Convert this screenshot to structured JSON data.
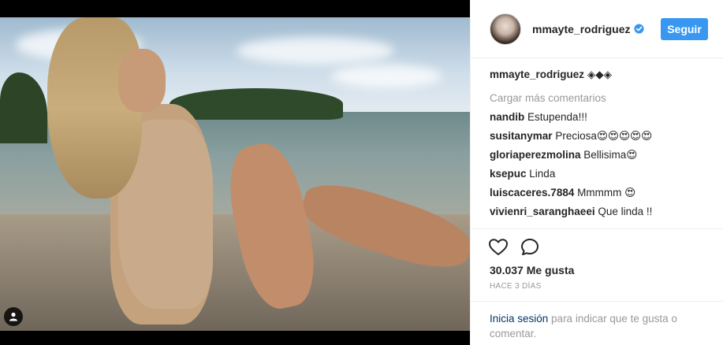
{
  "post": {
    "photo_alt": "",
    "author": {
      "username": "mmayte_rodriguez",
      "verified": true
    },
    "follow_label": "Seguir",
    "caption": {
      "username": "mmayte_rodriguez",
      "text": "◈◆◈"
    },
    "load_more_label": "Cargar más comentarios",
    "comments": [
      {
        "username": "nandib",
        "text": "Estupenda!!!"
      },
      {
        "username": "susitanymar",
        "text": "Preciosa😍😍😍😍😍"
      },
      {
        "username": "gloriaperezmolina",
        "text": "Bellisima😍"
      },
      {
        "username": "ksepuc",
        "text": "Linda"
      },
      {
        "username": "luiscaceres.7884",
        "text": "Mmmmm 😍"
      },
      {
        "username": "vivienri_saranghaeei",
        "text": "Que linda !!"
      },
      {
        "username": "",
        "text": "…"
      }
    ],
    "likes": "30.037 Me gusta",
    "timestamp": "HACE 3 DÍAS",
    "login_prompt": {
      "link": "Inicia sesión",
      "text": " para indicar que te gusta o comentar."
    }
  },
  "colors": {
    "accent": "#3897f0",
    "link": "#003569",
    "muted": "#999999",
    "border": "#efefef"
  },
  "icons": [
    "user-tag-icon",
    "verified-badge-icon",
    "heart-icon",
    "comment-bubble-icon"
  ]
}
